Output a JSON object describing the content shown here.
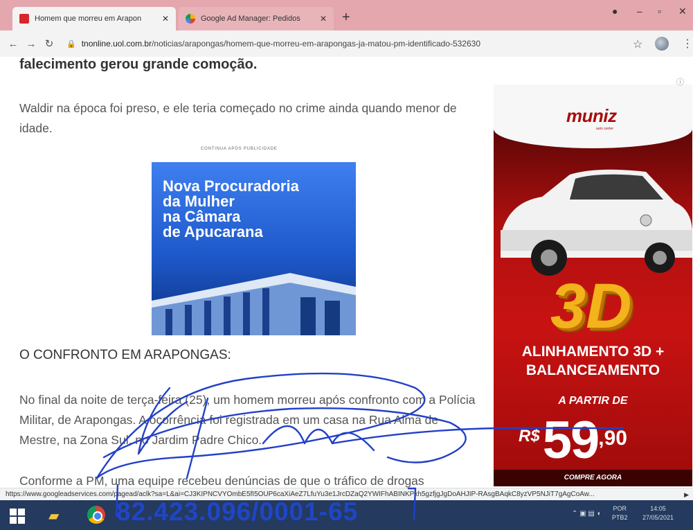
{
  "browser": {
    "tabs": [
      {
        "title": "Homem que morreu em Arapon",
        "active": true
      },
      {
        "title": "Google Ad Manager: Pedidos",
        "active": false
      }
    ],
    "new_tab_label": "+",
    "window_controls": {
      "minimize": "–",
      "maximize": "▫",
      "close": "✕"
    },
    "url_domain": "tnonline.uol.com.br",
    "url_path": "/noticias/arapongas/homem-que-morreu-em-arapongas-ja-matou-pm-identificado-532630"
  },
  "article": {
    "lead_bold": "falecimento gerou grande comoção.",
    "para1": "Waldir na época foi preso, e ele teria começado no crime ainda quando menor de idade.",
    "continua": "CONTINUA APÓS PUBLICIDADE",
    "inline_ad_title": "Nova Procuradoria\nda Mulher\nna Câmara\nde Apucarana",
    "section_title": "O CONFRONTO EM ARAPONGAS:",
    "para2": "No final da noite de terça-feira (25), um homem morreu após confronto com a Polícia Militar, de Arapongas. A ocorrência foi registrada em um casa na Rua Alma de Mestre, na Zona Sul, no Jardim Padre Chico.",
    "para3": "Conforme a PM, uma equipe recebeu denúncias de que o tráfico de drogas"
  },
  "side_ad": {
    "brand": "muniz",
    "brand_sub": "auto center",
    "badge": "3D",
    "headline": "ALINHAMENTO 3D +\nBALANCEAMENTO",
    "from_label": "A PARTIR DE",
    "currency": "R$",
    "price_main": "59",
    "price_cents": ",90",
    "cta": "COMPRE AGORA"
  },
  "status_url": "https://www.googleadservices.com/pagead/aclk?sa=L&ai=CJ3KIPNCVYOmbE5fI5OUP6caXiAeZ7LfuYu3e1JrcDZaQ2YWIFhABINKPxh5gzfjgJgDoAHJIP-RAsgBAqkC8yzVP5NJiT7gAgCoAw...",
  "taskbar": {
    "lang": "POR\nPTB2",
    "clock": "14:05\n27/05/2021"
  },
  "stamp": "82.423.096/0001-65",
  "colors": {
    "tab_strip": "#e3a7ad",
    "ad_red": "#c81212",
    "stamp_blue": "#1f46c6",
    "taskbar": "#243a5e"
  }
}
